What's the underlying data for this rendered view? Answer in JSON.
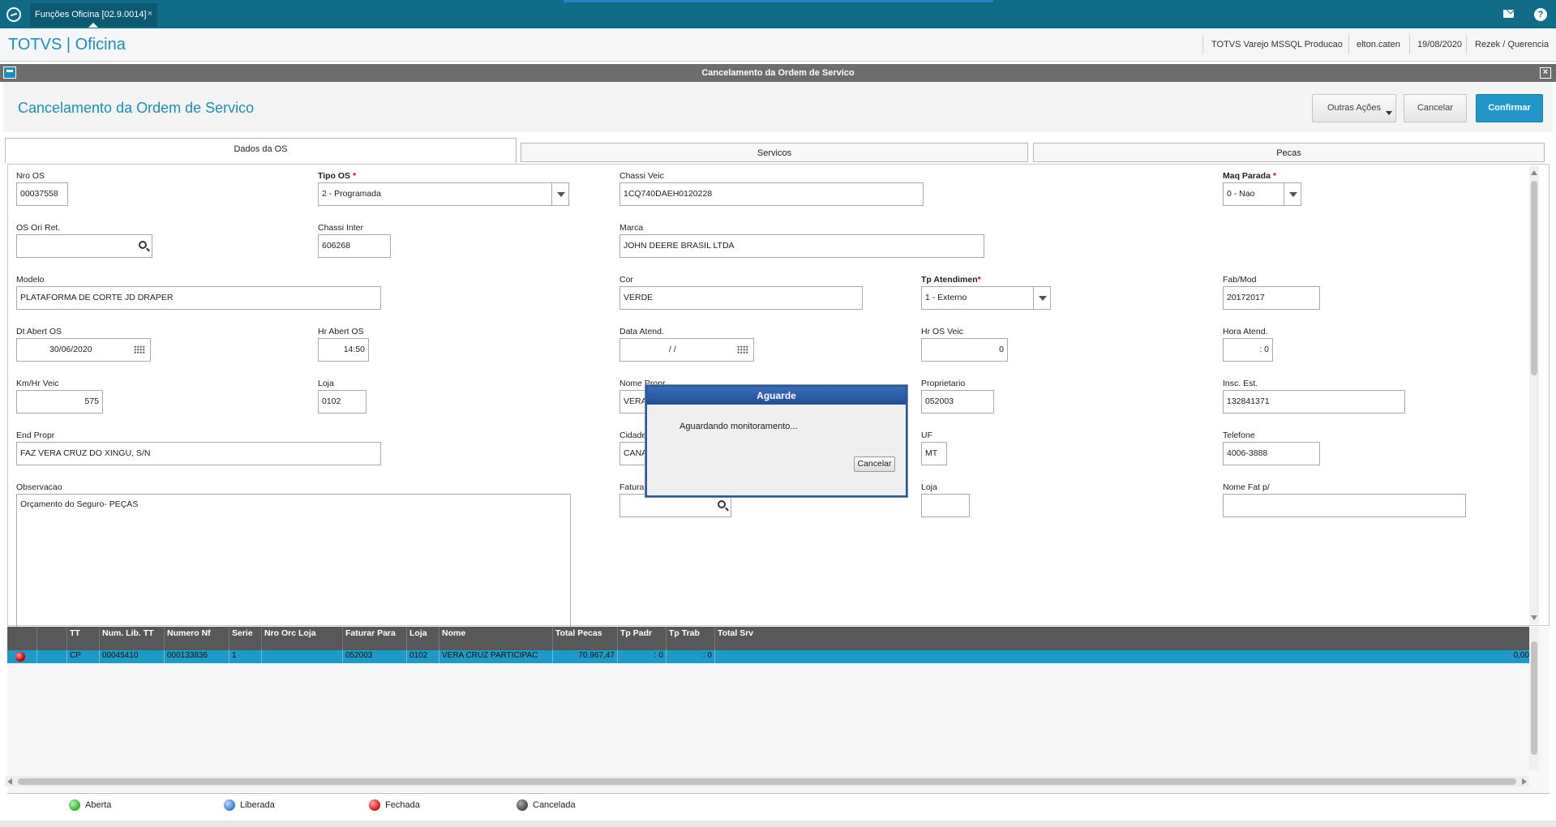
{
  "topbar": {
    "tab_label": "Funções Oficina [02.9.0014]",
    "tab_close": "×",
    "help": "?"
  },
  "header": {
    "brand": "TOTVS | Oficina",
    "env": "TOTVS Varejo MSSQL Producao",
    "user": "elton.caten",
    "date": "19/08/2020",
    "branch": "Rezek / Querencia"
  },
  "window": {
    "title": "Cancelamento da Ordem de Servico",
    "close": "×"
  },
  "form": {
    "title": "Cancelamento da Ordem de Servico",
    "btn_other": "Outras Ações",
    "btn_cancel": "Cancelar",
    "btn_confirm": "Confirmar"
  },
  "tabs": [
    "Dados da OS",
    "Servicos",
    "Pecas"
  ],
  "fields": {
    "nro_os": {
      "label": "Nro OS",
      "value": "00037558"
    },
    "tipo_os": {
      "label": "Tipo OS",
      "value": "2 - Programada"
    },
    "chassi_veic": {
      "label": "Chassi Veic",
      "value": "1CQ740DAEH0120228"
    },
    "maq_parada": {
      "label": "Maq Parada",
      "value": "0 - Nao"
    },
    "os_ori_ret": {
      "label": "OS Ori Ret.",
      "value": ""
    },
    "chassi_inter": {
      "label": "Chassi Inter",
      "value": "606268"
    },
    "marca": {
      "label": "Marca",
      "value": "JOHN DEERE BRASIL LTDA"
    },
    "modelo": {
      "label": "Modelo",
      "value": "PLATAFORMA DE CORTE JD DRAPER"
    },
    "cor": {
      "label": "Cor",
      "value": "VERDE"
    },
    "tp_atendimen": {
      "label": "Tp Atendimen",
      "value": "1 - Externo"
    },
    "fab_mod": {
      "label": "Fab/Mod",
      "value": "20172017"
    },
    "dt_abert_os": {
      "label": "Dt Abert OS",
      "value": "30/06/2020"
    },
    "hr_abert_os": {
      "label": "Hr Abert OS",
      "value": "14:50"
    },
    "data_atend": {
      "label": "Data Atend.",
      "value": "/  /"
    },
    "hr_os_veic": {
      "label": "Hr OS Veic",
      "value": "0"
    },
    "hora_atend": {
      "label": "Hora Atend.",
      "value": ": 0"
    },
    "km_hr_veic": {
      "label": "Km/Hr Veic",
      "value": "575"
    },
    "loja": {
      "label": "Loja",
      "value": "0102"
    },
    "nome_propr": {
      "label": "Nome Propr",
      "value": "VERA"
    },
    "proprietario": {
      "label": "Proprietario",
      "value": "052003"
    },
    "insc_est": {
      "label": "Insc. Est.",
      "value": "132841371"
    },
    "end_propr": {
      "label": "End Propr",
      "value": "FAZ VERA CRUZ DO XINGU, S/N"
    },
    "cidade": {
      "label": "Cidade",
      "value": "CANA"
    },
    "uf": {
      "label": "UF",
      "value": "MT"
    },
    "telefone": {
      "label": "Telefone",
      "value": "4006-3888"
    },
    "observacao": {
      "label": "Observacao",
      "value": "Orçamento do Seguro- PEÇAS"
    },
    "faturar": {
      "label": "Fatura",
      "value": ""
    },
    "loja2": {
      "label": "Loja",
      "value": ""
    },
    "nome_fat": {
      "label": "Nome Fat p/",
      "value": ""
    }
  },
  "dialog": {
    "title": "Aguarde",
    "message": "Aguardando monitoramento...",
    "button": "Cancelar"
  },
  "grid": {
    "columns": [
      "",
      "",
      "TT",
      "Num. Lib. TT",
      "Numero Nf",
      "Serie",
      "Nro Orc Loja",
      "Faturar Para",
      "Loja",
      "Nome",
      "Total Pecas",
      "Tp Padr",
      "Tp Trab",
      "Total Srv"
    ],
    "rows": [
      {
        "status": "red",
        "tt": "CP",
        "num_lib": "00045410",
        "numero_nf": "000133836",
        "serie": "1",
        "nro_orc": "",
        "faturar_para": "052003",
        "loja": "0102",
        "nome": "VERA CRUZ PARTICIPAC",
        "total_pecas": "70.967,47",
        "tp_padr": ": 0",
        "tp_trab": ": 0",
        "total_srv": "0,00"
      }
    ]
  },
  "legend": [
    {
      "label": "Aberta",
      "color": "#3cbf3c"
    },
    {
      "label": "Liberada",
      "color": "#4a86d8"
    },
    {
      "label": "Fechada",
      "color": "#e02020"
    },
    {
      "label": "Cancelada",
      "color": "#555555"
    }
  ]
}
